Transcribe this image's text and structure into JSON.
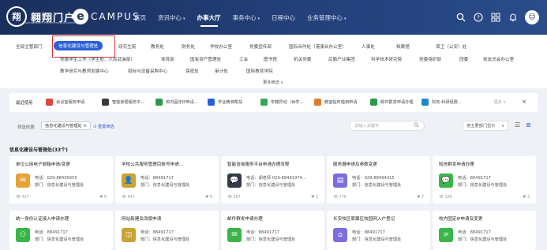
{
  "header": {
    "logo_emblem": "翔",
    "logo_text": "翱翔门户",
    "logo_sub": "Northwestern Polytechnical University",
    "ecampus_letter": "e",
    "ecampus_text": "CAMPUS",
    "nav": [
      "首页",
      "资讯中心",
      "办事大厅",
      "事务中心",
      "日程中心",
      "业务管理中心"
    ],
    "active_nav_index": 2,
    "icons": [
      "search-icon",
      "help-icon",
      "grid-icon",
      "bell-icon",
      "avatar"
    ]
  },
  "departments": {
    "row1": [
      "全部主管部门",
      "信息化建设与管理处",
      "研究生院",
      "教务处",
      "财务处",
      "学校办公室",
      "党委宣传部",
      "国际合作处（港澳台办公室）",
      "人事处",
      "档案馆",
      "保卫（公安）处"
    ],
    "row2": [
      "党委学生工作（学生处、人民武装部）",
      "体育部",
      "国有资产管理处",
      "工会",
      "图书馆",
      "机关党委",
      "后勤产业集团",
      "科学技术研究院",
      "党委组织部",
      "团委",
      "校友总会办公室"
    ],
    "row3": [
      "教学研究与教师发展中心",
      "招标与设备采购中心",
      "保密处",
      "审计处",
      "国际教育学院"
    ],
    "active": "信息化建设与管理处",
    "more_filter": "更多筛选 ∨"
  },
  "recent": {
    "label": "最近使用",
    "items": [
      {
        "label": "会议室服务申请",
        "color": "#e0463c"
      },
      {
        "label": "智能家居服务平...",
        "color": "#3a3a3a"
      },
      {
        "label": "校内固定IP申请...",
        "color": "#2b9a4a"
      },
      {
        "label": "学业精准帮扶",
        "color": "#2b5fd9"
      },
      {
        "label": "学籍异动（休学...",
        "color": "#3ba55c"
      },
      {
        "label": "教室临时借用申请",
        "color": "#e07b2a"
      },
      {
        "label": "邮件群发申请办理",
        "color": "#2b9a4a"
      },
      {
        "label": "财务-科研经费...",
        "color": "#1e88c8"
      }
    ],
    "more": "更多 ∨",
    "close": "×"
  },
  "filterbar": {
    "label": "筛选依据",
    "tag": "信息化建设与管理处 ×",
    "reset": "↺ 重置筛选",
    "search_placeholder": "请输入关键字",
    "sort": "按主要部门显示",
    "view_icons": [
      "list-view-icon",
      "detail-view-icon"
    ]
  },
  "section_title": "信息化建设与管理处(33个)",
  "cards": [
    {
      "title": "单位公用电子邮箱申请/变更",
      "icon_color": "#e8a23a",
      "phone": "电话：029-88495655",
      "dept": "部门：信息化建设与管理处",
      "views": "427",
      "likes": "6"
    },
    {
      "title": "学校公共服务管理目账号申请...",
      "icon_color": "#c9a233",
      "phone": "电话：88491717",
      "dept": "部门：信息化建设与管理处",
      "views": "641",
      "likes": "8"
    },
    {
      "title": "智能咨询服务平台申请办理流程",
      "icon_color": "#333a4a",
      "phone": "电话：胡老师 029-88491974...",
      "dept": "部门：信息化建设与管理处",
      "views": "167",
      "likes": "2"
    },
    {
      "title": "服务器申请及参数变更",
      "icon_color": "#7b6fe0",
      "phone": "电话：029-88494315",
      "dept": "部门：信息化建设与管理处",
      "views": "776",
      "likes": "7"
    },
    {
      "title": "短信群发申请办理",
      "icon_color": "#3bb54a",
      "phone": "电话：88491717",
      "dept": "部门：信息化建设与管理处",
      "views": "180",
      "likes": "3"
    },
    {
      "title": "统一身份认证接入申请办理",
      "icon_color": "#3bb54a",
      "phone": "电话：88491717",
      "dept": "部门：信息化建设与管理处"
    },
    {
      "title": "网站新建及改版申请",
      "icon_color": "#c9a233",
      "phone": "电话：88491717",
      "dept": "部门：信息化建设与管理处"
    },
    {
      "title": "邮件群发申请办理",
      "icon_color": "#3bb54a",
      "phone": "电话：88491717",
      "dept": "部门：信息化建设与管理处"
    },
    {
      "title": "长安校区家属区校园网入户登记",
      "icon_color": "#7b6fe0",
      "phone": "电话：88491717",
      "dept": "部门：信息化建设与管理处"
    },
    {
      "title": "校内固定IP申请及变更",
      "icon_color": "#3bb54a",
      "phone": "电话：88491717",
      "dept": "部门：信息化建设与管理处"
    }
  ]
}
